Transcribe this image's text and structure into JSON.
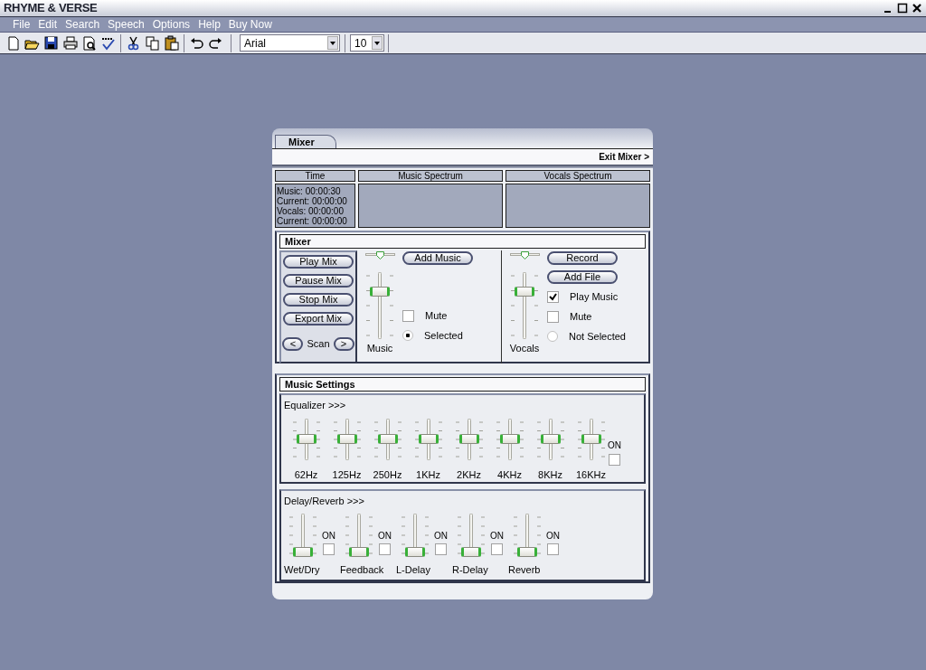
{
  "window": {
    "title": "RHYME & VERSE"
  },
  "menu": [
    "File",
    "Edit",
    "Search",
    "Speech",
    "Options",
    "Help",
    "Buy Now"
  ],
  "toolbar": {
    "font": "Arial",
    "size": "10"
  },
  "mixer_panel": {
    "tab": "Mixer",
    "exit": "Exit Mixer >",
    "time": {
      "heading": "Time",
      "lines": [
        "Music: 00:00:30",
        "Current: 00:00:00",
        "Vocals: 00:00:00",
        "Current: 00:00:00"
      ]
    },
    "music_spectrum": {
      "heading": "Music Spectrum"
    },
    "vocals_spectrum": {
      "heading": "Vocals Spectrum"
    },
    "mixer": {
      "heading": "Mixer",
      "transport": [
        "Play Mix",
        "Pause Mix",
        "Stop Mix",
        "Export Mix"
      ],
      "scan": {
        "label": "Scan",
        "prev": "<",
        "next": ">"
      },
      "channels": [
        {
          "name": "Music",
          "pan": {
            "level": 0.5
          },
          "level": 0.75,
          "buttons": [
            "Add Music"
          ],
          "options": [
            {
              "kind": "checkbox",
              "label": "Mute",
              "checked": false
            },
            {
              "kind": "radio",
              "label": "Selected",
              "checked": true
            }
          ]
        },
        {
          "name": "Vocals",
          "pan": {
            "level": 0.5
          },
          "level": 0.75,
          "buttons": [
            "Record",
            "Add File"
          ],
          "options": [
            {
              "kind": "checkbox",
              "label": "Play Music",
              "checked": true
            },
            {
              "kind": "checkbox",
              "label": "Mute",
              "checked": false
            },
            {
              "kind": "radio",
              "label": "Not Selected",
              "checked": false
            }
          ]
        }
      ]
    },
    "music_settings": {
      "heading": "Music Settings",
      "equalizer": {
        "title": "Equalizer >>>",
        "on_label": "ON",
        "on": false,
        "bands": [
          {
            "label": "62Hz",
            "level": 0.5
          },
          {
            "label": "125Hz",
            "level": 0.5
          },
          {
            "label": "250Hz",
            "level": 0.5
          },
          {
            "label": "1KHz",
            "level": 0.5
          },
          {
            "label": "2KHz",
            "level": 0.5
          },
          {
            "label": "4KHz",
            "level": 0.5
          },
          {
            "label": "8KHz",
            "level": 0.5
          },
          {
            "label": "16KHz",
            "level": 0.5
          }
        ]
      },
      "delay_reverb": {
        "title": "Delay/Reverb >>>",
        "controls": [
          {
            "label": "Wet/Dry",
            "level": 0,
            "on_label": "ON",
            "on": false
          },
          {
            "label": "Feedback",
            "level": 0,
            "on_label": "ON",
            "on": false
          },
          {
            "label": "L-Delay",
            "level": 0,
            "on_label": "ON",
            "on": false
          },
          {
            "label": "R-Delay",
            "level": 0,
            "on_label": "ON",
            "on": false
          },
          {
            "label": "Reverb",
            "level": 0,
            "on_label": "ON",
            "on": false
          }
        ]
      }
    }
  }
}
